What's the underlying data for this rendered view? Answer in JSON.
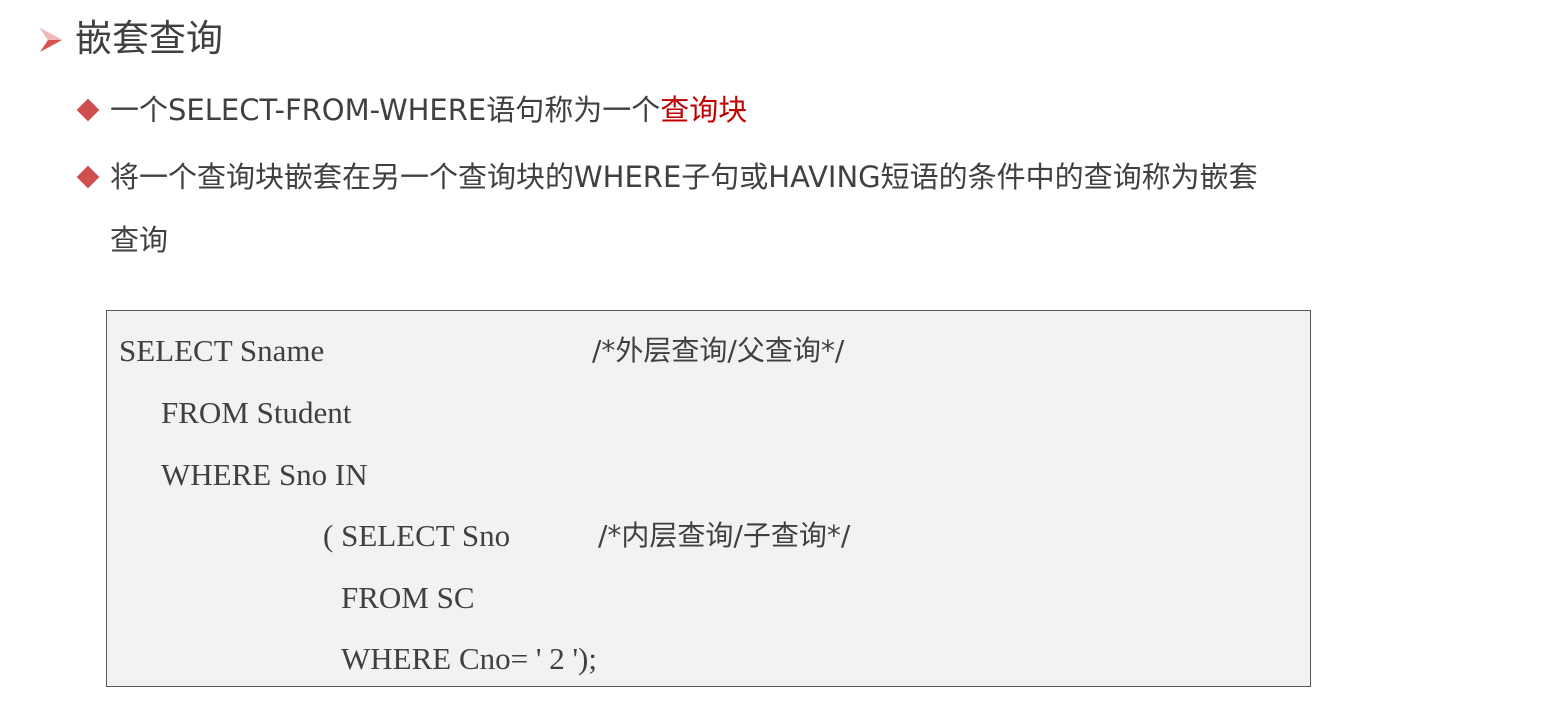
{
  "heading": {
    "text": "嵌套查询",
    "icon": "arrow-bullet-icon",
    "accent": "#cf4f4f"
  },
  "bullets": [
    {
      "text_before": "一个SELECT-FROM-WHERE语句称为一个",
      "highlight": "查询块",
      "highlight_color": "#c00000"
    },
    {
      "line1": "将一个查询块嵌套在另一个查询块的WHERE子句或HAVING短语的条件中的查询称为嵌套",
      "line2": "查询"
    }
  ],
  "code": {
    "lines": [
      {
        "code": "SELECT Sname",
        "comment": "/*外层查询/父查询*/"
      },
      {
        "code": "FROM Student"
      },
      {
        "code": "WHERE Sno IN"
      },
      {
        "code": "( SELECT Sno",
        "comment": "/*内层查询/子查询*/"
      },
      {
        "code": "FROM SC"
      },
      {
        "code": "WHERE Cno= ' 2 ');"
      }
    ]
  }
}
